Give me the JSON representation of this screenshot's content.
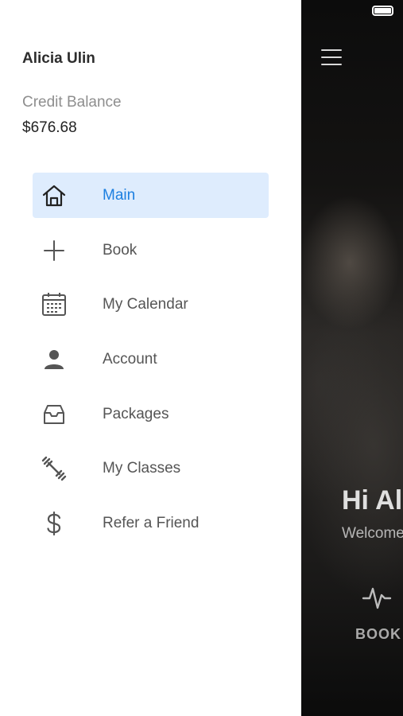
{
  "user": {
    "name": "Alicia Ulin"
  },
  "credit": {
    "label": "Credit Balance",
    "value": "$676.68"
  },
  "menu": {
    "items": [
      {
        "label": "Main",
        "icon": "home-icon",
        "active": true
      },
      {
        "label": "Book",
        "icon": "plus-icon"
      },
      {
        "label": "My Calendar",
        "icon": "calendar-icon"
      },
      {
        "label": "Account",
        "icon": "person-icon"
      },
      {
        "label": "Packages",
        "icon": "inbox-icon"
      },
      {
        "label": "My Classes",
        "icon": "dumbbell-icon"
      },
      {
        "label": "Refer a Friend",
        "icon": "dollar-icon"
      }
    ]
  },
  "background": {
    "greeting": "Hi Al",
    "welcome": "Welcome",
    "book_label": "BOOK"
  },
  "colors": {
    "accent": "#1c7fe0",
    "active_bg": "#deecfd",
    "drawer_bg": "#ffffff"
  }
}
